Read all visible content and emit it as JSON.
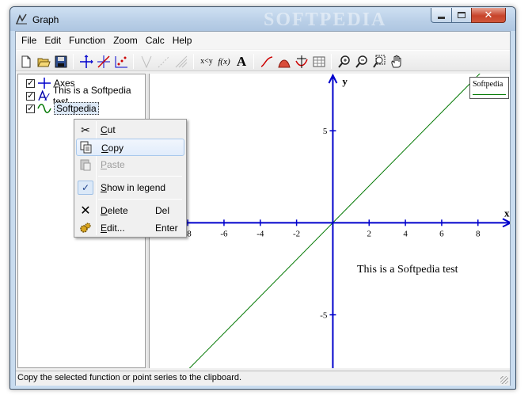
{
  "window": {
    "title": "Graph",
    "watermark": "SOFTPEDIA",
    "controls": {
      "minimize": "minimize",
      "maximize": "maximize",
      "close": "close"
    }
  },
  "menubar": [
    "File",
    "Edit",
    "Function",
    "Zoom",
    "Calc",
    "Help"
  ],
  "toolbar": {
    "text_buttons": {
      "xy": "x<y",
      "fx": "f(x)",
      "text": "A"
    }
  },
  "tree": {
    "items": [
      {
        "label": "Axes",
        "checked": true,
        "icon": "axes-icon"
      },
      {
        "label": "This is a Softpedia test",
        "checked": true,
        "icon": "text-label-icon"
      },
      {
        "label": "Softpedia",
        "checked": true,
        "icon": "function-curve-icon"
      }
    ]
  },
  "context_menu": {
    "cut": "Cut",
    "copy": "Copy",
    "paste": "Paste",
    "show_in_legend": "Show in legend",
    "delete": "Delete",
    "delete_shortcut": "Del",
    "edit": "Edit...",
    "edit_shortcut": "Enter"
  },
  "plot": {
    "legend_label": "Softpedia",
    "text_label": "This is a Softpedia test",
    "axis_x_label": "x",
    "axis_y_label": "y",
    "x_ticks": [
      "-8",
      "-6",
      "-4",
      "-2",
      "2",
      "4",
      "6",
      "8"
    ],
    "y_ticks": [
      "5",
      "-5"
    ],
    "colors": {
      "axes": "#0000cc",
      "function": "#007700"
    }
  },
  "chart_data": {
    "type": "line",
    "series": [
      {
        "name": "Softpedia",
        "x": [
          -10,
          10
        ],
        "y": [
          -10,
          10
        ]
      }
    ],
    "xlabel": "x",
    "ylabel": "y",
    "xlim": [
      -10.1,
      9.8
    ],
    "ylim": [
      -7.9,
      8.1
    ],
    "grid": false,
    "legend": "top-right",
    "annotations": [
      "This is a Softpedia test"
    ]
  },
  "status": {
    "text": "Copy the selected function or point series to the clipboard."
  }
}
